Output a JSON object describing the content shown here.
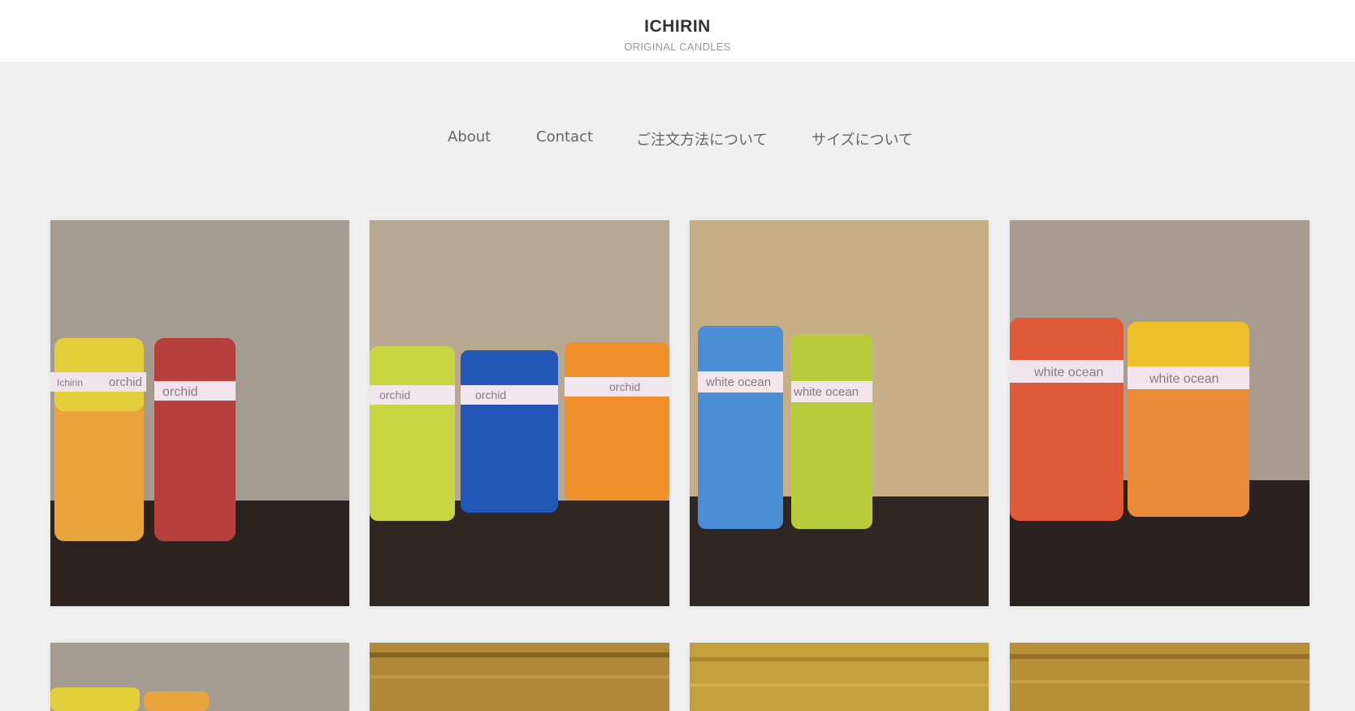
{
  "header": {
    "title": "ICHIRIN",
    "tagline": "ORIGINAL CANDLES"
  },
  "nav": {
    "items": [
      {
        "label": "About"
      },
      {
        "label": "Contact"
      },
      {
        "label": "ご注文方法について"
      },
      {
        "label": "サイズについて"
      }
    ]
  },
  "gallery": {
    "row1": [
      {
        "labels": [
          "Ichirin",
          "orchid",
          "orchid"
        ]
      },
      {
        "labels": [
          "orchid",
          "orchid",
          "orchid"
        ]
      },
      {
        "labels": [
          "white ocean",
          "white ocean"
        ]
      },
      {
        "labels": [
          "white ocean",
          "white ocean"
        ]
      }
    ]
  },
  "colors": {
    "page_bg": "#f0f0f0",
    "header_bg": "#ffffff",
    "title": "#333333",
    "tagline": "#999999",
    "nav_text": "#666666"
  }
}
